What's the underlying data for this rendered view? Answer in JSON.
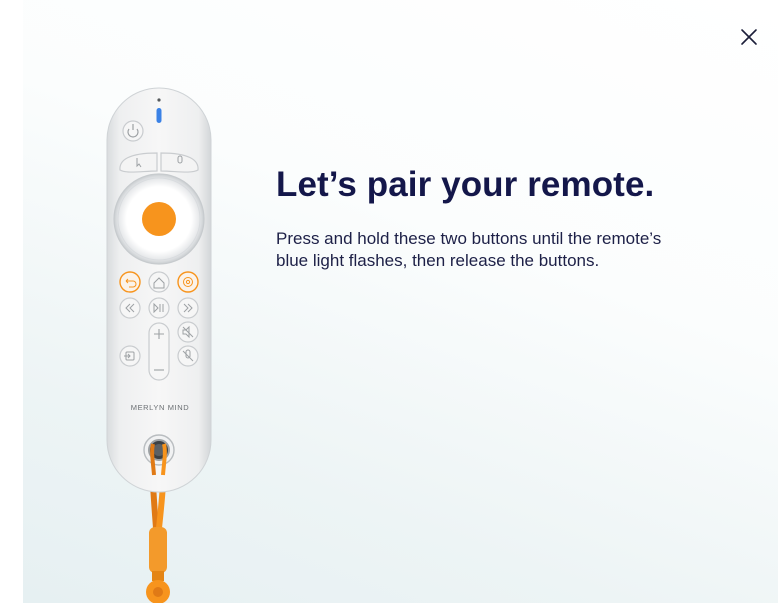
{
  "dialog": {
    "title": "Let’s pair your remote.",
    "instructions": "Press and hold these two buttons until the remote’s blue light flashes, then release the buttons."
  },
  "remote": {
    "brand_label": "MERLYN MIND",
    "accent_color": "#f7941d",
    "led_color": "#3b82e6"
  },
  "icons": {
    "close": "close-icon"
  }
}
